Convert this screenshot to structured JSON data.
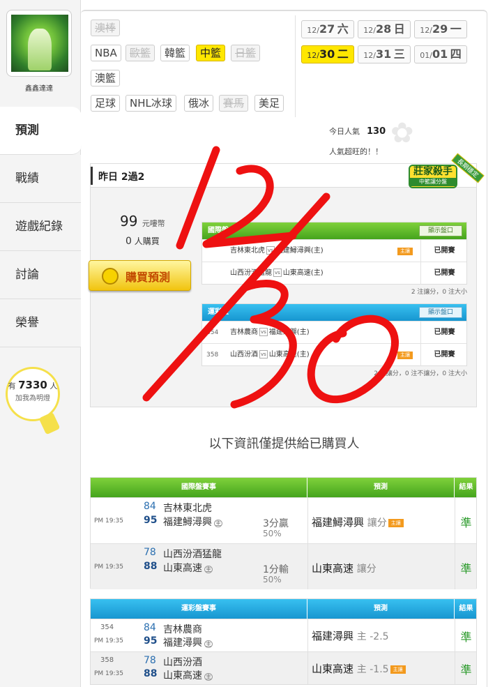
{
  "sidebar": {
    "username": "鑫鑫達達",
    "items": [
      {
        "label": "預測"
      },
      {
        "label": "戰績"
      },
      {
        "label": "遊戲紀錄"
      },
      {
        "label": "討論"
      },
      {
        "label": "榮譽"
      }
    ],
    "fans_prefix": "有",
    "fans_count": "7330",
    "fans_suffix": "人",
    "fans_cta": "加我為明燈"
  },
  "league_tags": [
    {
      "label": "澳棒",
      "state": "disabled"
    },
    {
      "label": "NBA",
      "state": "normal"
    },
    {
      "label": "歐籃",
      "state": "disabled"
    },
    {
      "label": "韓籃",
      "state": "normal"
    },
    {
      "label": "中籃",
      "state": "selected"
    },
    {
      "label": "日籃",
      "state": "disabled"
    },
    {
      "label": "澳籃",
      "state": "normal"
    },
    {
      "label": "足球",
      "state": "normal"
    },
    {
      "label": "NHL冰球",
      "state": "normal"
    },
    {
      "label": "俄冰",
      "state": "normal"
    },
    {
      "label": "賽馬",
      "state": "disabled"
    },
    {
      "label": "美足",
      "state": "normal"
    }
  ],
  "dates": [
    {
      "md": "12/",
      "day": "27",
      "wd": "六"
    },
    {
      "md": "12/",
      "day": "28",
      "wd": "日"
    },
    {
      "md": "12/",
      "day": "29",
      "wd": "一"
    },
    {
      "md": "12/",
      "day": "30",
      "wd": "二"
    },
    {
      "md": "12/",
      "day": "31",
      "wd": "三"
    },
    {
      "md": "01/",
      "day": "01",
      "wd": "四"
    }
  ],
  "popularity": {
    "label": "今日人氣",
    "value": "130",
    "note": "人氣超旺的！！"
  },
  "yesterday": {
    "label": "昨日 2過2"
  },
  "badge": {
    "title": "莊家殺手",
    "sub": "中籃讓分盤",
    "ribbon": "長期穩定"
  },
  "purchase": {
    "price": "99",
    "unit": "元嘍幣",
    "buyers": "0",
    "buyers_label": "人購買",
    "button": "購買預測"
  },
  "mini_intl": {
    "header": "國際盤",
    "show_label": "顯示盤口",
    "rows": [
      {
        "num": "",
        "away": "吉林東北虎",
        "vs": "vs",
        "home": "福建鱘潯興(主)",
        "host": "主讓",
        "status": "已開賽"
      },
      {
        "num": "",
        "away": "山西汾酒猛龍",
        "vs": "vs",
        "home": "山東高速(主)",
        "host": "",
        "status": "已開賽"
      }
    ],
    "footer": "2 注讓分，0 注大小"
  },
  "mini_lottery": {
    "header": "運彩盤",
    "show_label": "顯示盤口",
    "rows": [
      {
        "num": "354",
        "away": "吉林農商",
        "vs": "vs",
        "home": "福建潯興(主)",
        "host": "",
        "status": "已開賽"
      },
      {
        "num": "358",
        "away": "山西汾酒",
        "vs": "vs",
        "home": "山東高速(主)",
        "host": "主讓",
        "status": "已開賽"
      }
    ],
    "footer": "2 注讓分，0 注不讓分，0 注大小"
  },
  "info_text": "以下資訊僅提供給已購買人",
  "intl_table": {
    "headers": [
      "國際盤賽事",
      "預測",
      "結果"
    ],
    "rows": [
      {
        "num": "",
        "time": "PM 19:35",
        "s1": "84",
        "t1": "吉林東北虎",
        "s2": "95",
        "t2": "福建鱘潯興",
        "home_mark": "主",
        "res1": "3分贏",
        "res2": "50%",
        "pred_team": "福建鱘潯興",
        "pred_type": "讓分",
        "pred_host": "主讓",
        "result": "準"
      },
      {
        "num": "",
        "time": "PM 19:35",
        "s1": "78",
        "t1": "山西汾酒猛龍",
        "s2": "88",
        "t2": "山東高速",
        "home_mark": "主",
        "res1": "1分輸",
        "res2": "50%",
        "pred_team": "山東高速",
        "pred_type": "讓分",
        "pred_host": "",
        "result": "準"
      }
    ]
  },
  "lottery_table": {
    "headers": [
      "運彩盤賽事",
      "預測",
      "結果"
    ],
    "rows": [
      {
        "num": "354",
        "time": "PM 19:35",
        "s1": "84",
        "t1": "吉林農商",
        "s2": "95",
        "t2": "福建潯興",
        "home_mark": "主",
        "pred_team": "福建潯興",
        "pred_type": "主 -2.5",
        "pred_host": "",
        "result": "準"
      },
      {
        "num": "358",
        "time": "PM 19:35",
        "s1": "78",
        "t1": "山西汾酒",
        "s2": "88",
        "t2": "山東高速",
        "home_mark": "主",
        "pred_team": "山東高速",
        "pred_type": "主 -1.5",
        "pred_host": "主讓",
        "result": "準"
      }
    ]
  },
  "annotation": {
    "text": "12/30",
    "color": "#ee1111"
  }
}
